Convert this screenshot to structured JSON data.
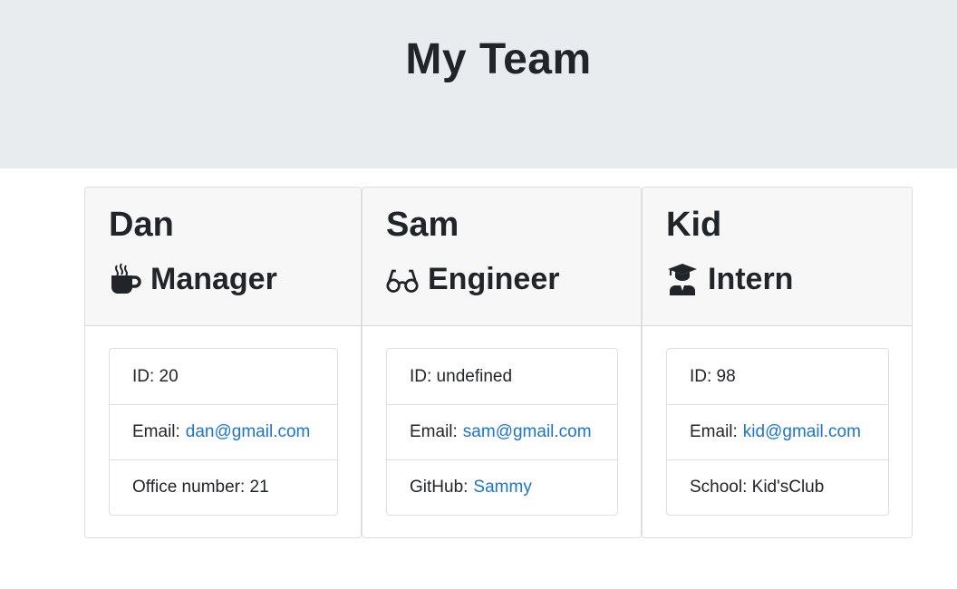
{
  "page": {
    "title": "My Team"
  },
  "members": [
    {
      "name": "Dan",
      "role": "Manager",
      "icon": "coffee-icon",
      "id_label": "ID: 20",
      "email_label": "Email:",
      "email": "dan@gmail.com",
      "extra_label": "Office number: 21",
      "extra_link": ""
    },
    {
      "name": "Sam",
      "role": "Engineer",
      "icon": "glasses-icon",
      "id_label": "ID: undefined",
      "email_label": "Email:",
      "email": "sam@gmail.com",
      "extra_label": "GitHub:",
      "extra_link": "Sammy"
    },
    {
      "name": "Kid",
      "role": "Intern",
      "icon": "graduate-icon",
      "id_label": "ID: 98",
      "email_label": "Email:",
      "email": "kid@gmail.com",
      "extra_label": "School: Kid'sClub",
      "extra_link": ""
    }
  ],
  "colors": {
    "link": "#1a73d9",
    "header_bg": "#e9ecef",
    "card_header_bg": "#f7f7f7"
  }
}
